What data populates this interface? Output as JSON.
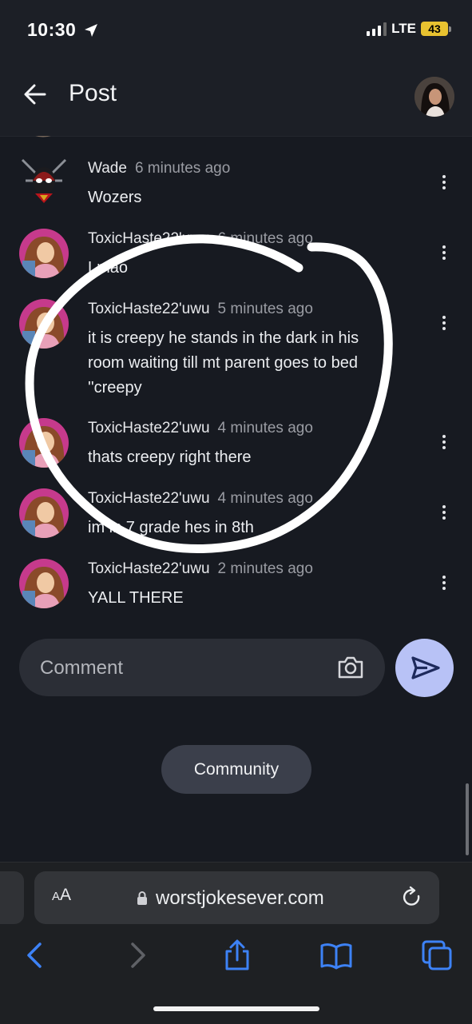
{
  "status_bar": {
    "time": "10:30",
    "network": "LTE",
    "battery": "43",
    "icons": [
      "location-arrow-icon",
      "signal-icon",
      "battery-icon"
    ]
  },
  "header": {
    "title": "Post",
    "back_icon": "arrow-left-icon"
  },
  "comments": [
    {
      "author": "Wade",
      "time": "6 minutes ago",
      "text": "Wozers"
    },
    {
      "author": "ToxicHaste22'uwu",
      "time": "6 minutes ago",
      "text": "Lmao"
    },
    {
      "author": "ToxicHaste22'uwu",
      "time": "5 minutes ago",
      "text": "it is creepy he stands in the dark in his room waiting till mt parent goes to bed ''creepy"
    },
    {
      "author": "ToxicHaste22'uwu",
      "time": "4 minutes ago",
      "text": "thats creepy right there"
    },
    {
      "author": "ToxicHaste22'uwu",
      "time": "4 minutes ago",
      "text": "im in 7 grade hes in 8th"
    },
    {
      "author": "ToxicHaste22'uwu",
      "time": "2 minutes ago",
      "text": "YALL THERE"
    }
  ],
  "comment_input": {
    "placeholder": "Comment"
  },
  "community_button": {
    "label": "Community"
  },
  "browser": {
    "aa_label_big": "A",
    "aa_label_small": "A",
    "url": "worstjokesever.com",
    "nav_icons": [
      "back-icon",
      "forward-icon",
      "share-icon",
      "bookmarks-icon",
      "tabs-icon"
    ]
  },
  "colors": {
    "background": "#171a21",
    "send_button": "#b8c2f6",
    "community_button": "#3b3f4b",
    "annotation_circle": "#ffffff"
  }
}
